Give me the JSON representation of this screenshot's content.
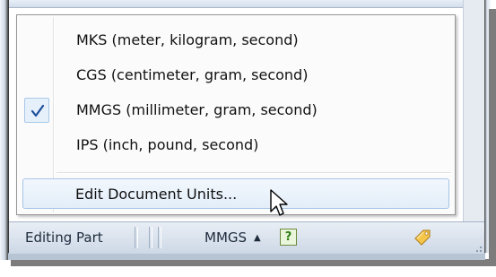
{
  "units_menu": {
    "items": [
      {
        "label": "MKS (meter, kilogram, second)",
        "checked": false
      },
      {
        "label": "CGS (centimeter, gram, second)",
        "checked": false
      },
      {
        "label": "MMGS (millimeter, gram, second)",
        "checked": true
      },
      {
        "label": "IPS (inch, pound, second)",
        "checked": false
      }
    ],
    "edit_units_label": "Edit Document Units..."
  },
  "status_bar": {
    "state_text": "Editing Part",
    "units_value": "MMGS",
    "units_arrow": "▲",
    "help_glyph": "?",
    "icons": [
      "help-icon",
      "tag-icon",
      "resize-grip-icon"
    ]
  },
  "colors": {
    "accent": "#3a70c1",
    "highlight_border": "#a6c5e6",
    "status_bar": "#cdd8e6"
  }
}
